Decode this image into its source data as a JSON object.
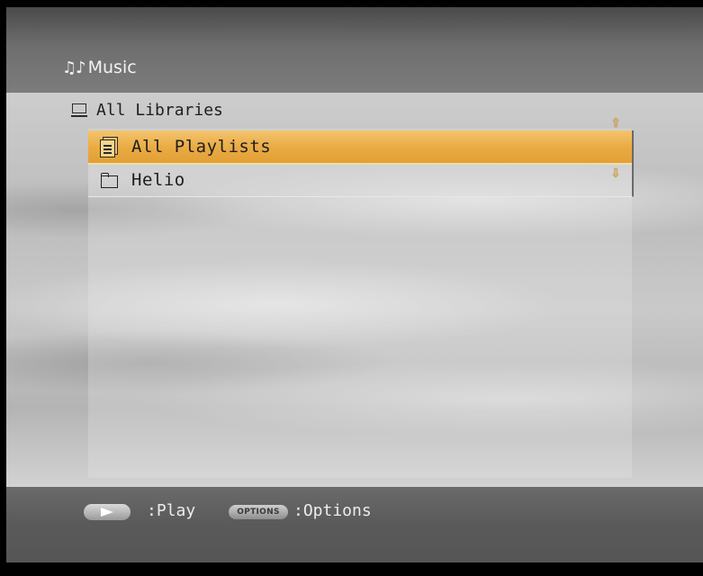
{
  "header": {
    "icon": "music-notes-icon",
    "title": "Music"
  },
  "breadcrumb": {
    "icon": "tv-icon",
    "label": "All Libraries"
  },
  "list": {
    "items": [
      {
        "label": "All Playlists",
        "icon": "playlist-icon",
        "selected": true
      },
      {
        "label": "Helio",
        "icon": "folder-icon",
        "selected": false
      }
    ]
  },
  "scroll": {
    "up_icon": "scroll-up-arrow-icon",
    "down_icon": "scroll-down-arrow-icon"
  },
  "footer": {
    "play_key_icon": "play-button-icon",
    "play_hint": ":Play",
    "options_key": "OPTIONS",
    "options_hint": ":Options"
  },
  "colors": {
    "selection": "#e9aa42",
    "arrow": "#f0a935",
    "header_bg": "#5e5e5e",
    "footer_bg": "#5a5a5a"
  }
}
